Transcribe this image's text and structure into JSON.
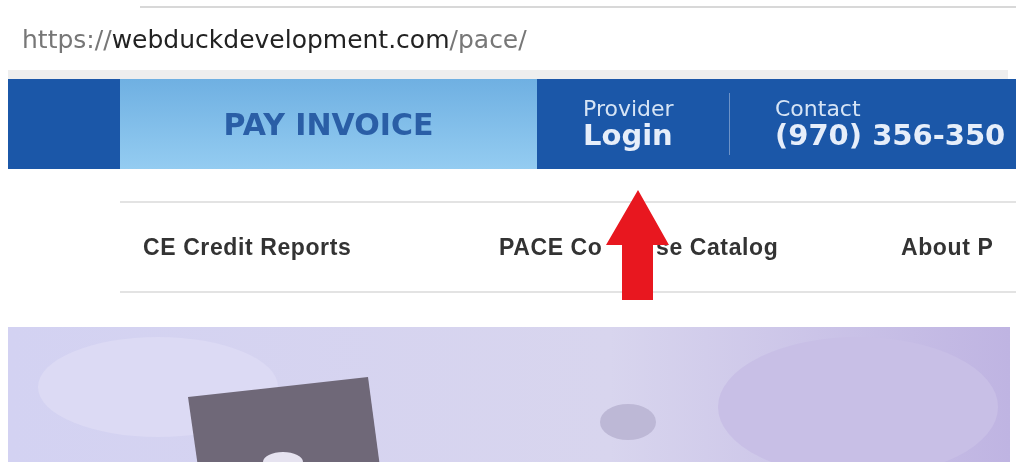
{
  "address_bar": {
    "scheme": "https://",
    "domain": "webduckdevelopment.com",
    "path": "/pace/"
  },
  "header": {
    "pay_button": "PAY INVOICE",
    "login": {
      "small": "Provider",
      "big": "Login"
    },
    "contact": {
      "small": "Contact",
      "big": "(970) 356-350"
    }
  },
  "nav": [
    {
      "label": "CE Credit Reports"
    },
    {
      "label": "PACE Co",
      "label_after_arrow": "se Catalog"
    },
    {
      "label": "About P"
    }
  ]
}
